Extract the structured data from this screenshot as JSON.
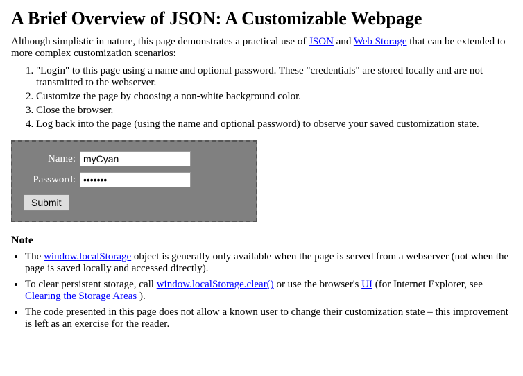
{
  "page": {
    "title": "A Brief Overview of JSON: A Customizable Webpage",
    "intro": "Although simplistic in nature, this page demonstrates a practical use of",
    "intro_link1": "JSON",
    "intro_mid": "and",
    "intro_link2": "Web Storage",
    "intro_end": "that can be extended to more complex customization scenarios:",
    "steps": [
      "\"Login\" to this page using a name and optional password. These \"credentials\" are stored locally and are not transmitted to the webserver.",
      "Customize the page by choosing a non-white background color.",
      "Close the browser.",
      "Log back into the page (using the name and optional password) to observe your saved customization state."
    ],
    "form": {
      "name_label": "Name:",
      "name_value": "myCyan",
      "password_label": "Password:",
      "password_value": "•••••••",
      "submit_label": "Submit"
    },
    "note_title": "Note",
    "notes": [
      {
        "before": "The",
        "link": "window.localStorage",
        "after": "object is generally only available when the page is served from a webserver (not when the page is saved locally and accessed directly)."
      },
      {
        "before": "To clear persistent storage, call",
        "link": "window.localStorage.clear()",
        "mid": "or use the browser's",
        "link2": "UI",
        "after": "(for Internet Explorer, see",
        "link3": "Clearing the Storage Areas",
        "end": ")."
      },
      {
        "text": "The code presented in this page does not allow a known user to change their customization state – this improvement is left as an exercise for the reader."
      }
    ]
  }
}
